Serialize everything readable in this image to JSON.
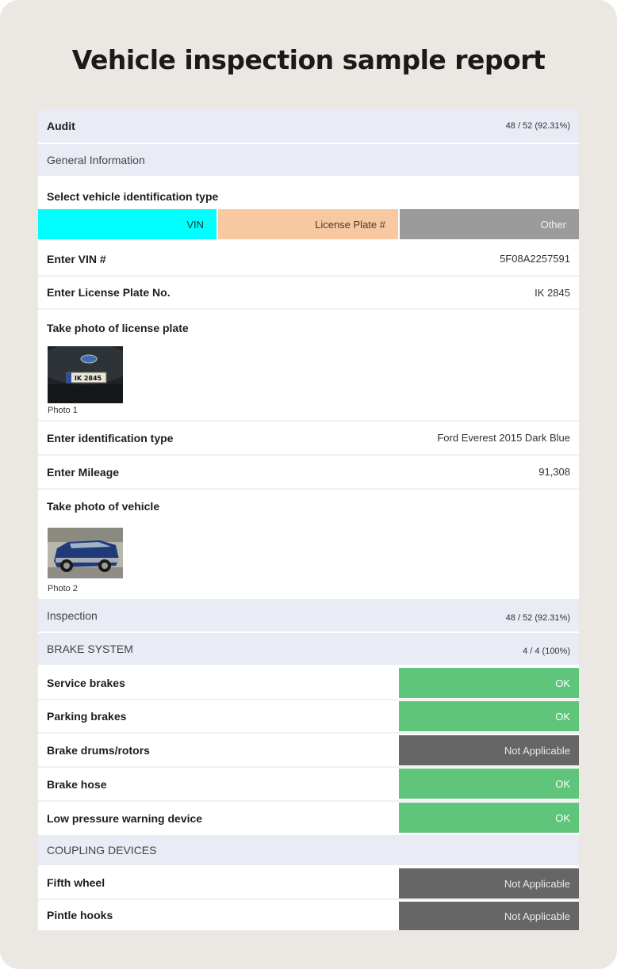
{
  "page_title": "Vehicle inspection sample report",
  "audit": {
    "label": "Audit",
    "score": "48 / 52 (92.31%)"
  },
  "general": {
    "label": "General Information"
  },
  "id_type": {
    "label": "Select vehicle identification type",
    "options": [
      "VIN",
      "License Plate #",
      "Other"
    ],
    "colors": {
      "vin": "#00ffff",
      "plate": "#f8c9a0",
      "other": "#9b9b9b"
    }
  },
  "vin": {
    "label": "Enter VIN #",
    "value": "5F08A2257591"
  },
  "plate_no": {
    "label": "Enter License Plate No.",
    "value": "IK 2845"
  },
  "plate_photo": {
    "label": "Take photo of license plate",
    "caption": "Photo 1",
    "plate_text": "IK 2845"
  },
  "ident": {
    "label": "Enter identification type",
    "value": "Ford Everest 2015 Dark Blue"
  },
  "mileage": {
    "label": "Enter Mileage",
    "value": "91,308"
  },
  "vehicle_photo": {
    "label": "Take photo of vehicle",
    "caption": "Photo 2"
  },
  "inspection": {
    "label": "Inspection",
    "score": "48 / 52 (92.31%)"
  },
  "brake_system": {
    "label": "BRAKE SYSTEM",
    "score": "4 / 4 (100%)",
    "items": [
      {
        "label": "Service brakes",
        "status": "OK"
      },
      {
        "label": "Parking brakes",
        "status": "OK"
      },
      {
        "label": "Brake drums/rotors",
        "status": "Not Applicable"
      },
      {
        "label": "Brake hose",
        "status": "OK"
      },
      {
        "label": "Low pressure warning device",
        "status": "OK"
      }
    ]
  },
  "coupling": {
    "label": "COUPLING DEVICES",
    "items": [
      {
        "label": "Fifth wheel",
        "status": "Not Applicable"
      },
      {
        "label": "Pintle hooks",
        "status": "Not Applicable"
      }
    ]
  },
  "colors": {
    "ok": "#5fc57a",
    "not_applicable": "#666666",
    "section_bg": "#e9ecf5"
  }
}
